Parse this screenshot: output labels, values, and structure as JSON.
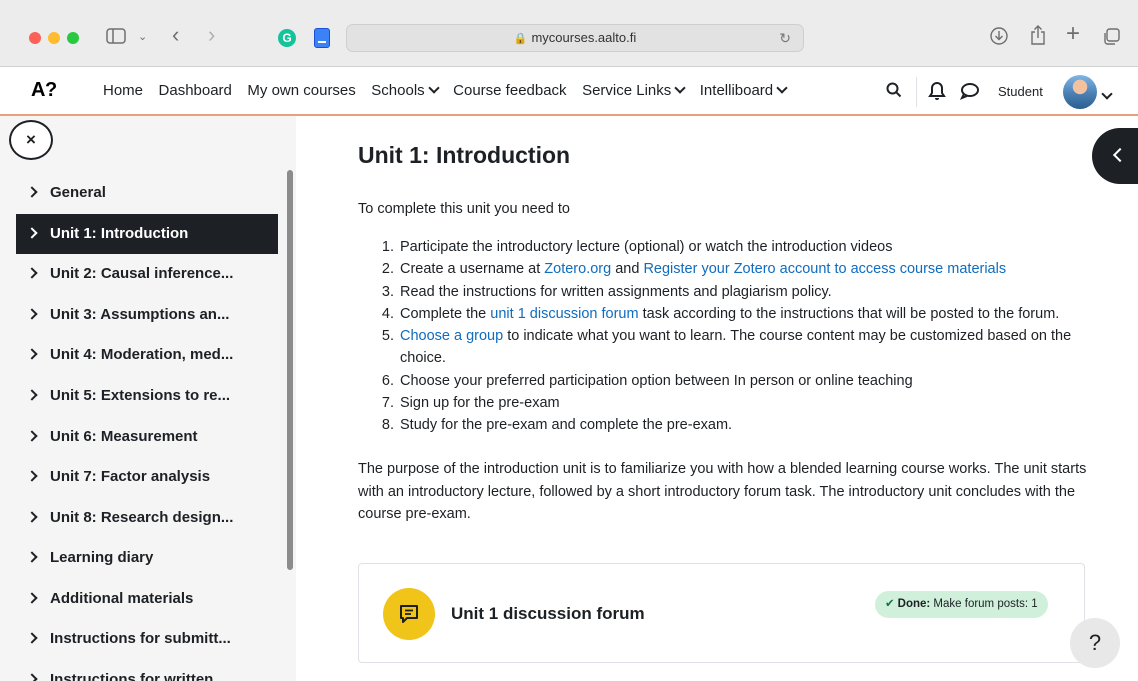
{
  "browser": {
    "url": "mycourses.aalto.fi",
    "extension_g": "G"
  },
  "nav": {
    "logo": "A?",
    "items": [
      "Home",
      "Dashboard",
      "My own courses",
      "Schools",
      "Course feedback",
      "Service Links",
      "Intelliboard"
    ],
    "user": "Student"
  },
  "sidebar": {
    "close_label": "×",
    "items": [
      "General",
      "Unit 1: Introduction",
      "Unit 2: Causal inference...",
      "Unit 3: Assumptions an...",
      "Unit 4: Moderation, med...",
      "Unit 5: Extensions to re...",
      "Unit 6: Measurement",
      "Unit 7: Factor analysis",
      "Unit 8: Research design...",
      "Learning diary",
      "Additional materials",
      "Instructions for submitt...",
      "Instructions for written..."
    ],
    "active_index": 1
  },
  "main": {
    "title": "Unit 1: Introduction",
    "intro": "To complete this unit you need to",
    "steps": {
      "s1": "Participate the introductory lecture (optional) or watch the introduction videos",
      "s2_a": "Create a username at ",
      "s2_link1": "Zotero.org",
      "s2_b": " and ",
      "s2_link2": "Register your Zotero account to access course materials",
      "s3": "Read the instructions for written assignments and plagiarism policy.",
      "s4_a": "Complete the ",
      "s4_link": "unit 1 discussion forum",
      "s4_b": " task according to the instructions that will be posted to the forum.",
      "s5_link": "Choose a group",
      "s5_b": " to indicate what you want to learn. The course content may be customized based on the choice.",
      "s6": "Choose your preferred participation option between In person or online teaching",
      "s7": "Sign up for the pre-exam",
      "s8": "Study for the pre-exam and complete the pre-exam."
    },
    "purpose": "The purpose of the introduction unit is to familiarize you with how a blended learning course works. The unit starts with an introductory lecture, followed by a short introductory forum task. The introductory unit concludes with the course pre-exam.",
    "card": {
      "title": "Unit 1 discussion forum",
      "done_label": "Done:",
      "done_text": " Make forum posts: 1"
    },
    "help": "?"
  },
  "colors": {
    "accent": "#0f6cbf",
    "active_bg": "#1d2125",
    "forum_icon": "#f0c419",
    "done_bg": "#d1f0db"
  }
}
